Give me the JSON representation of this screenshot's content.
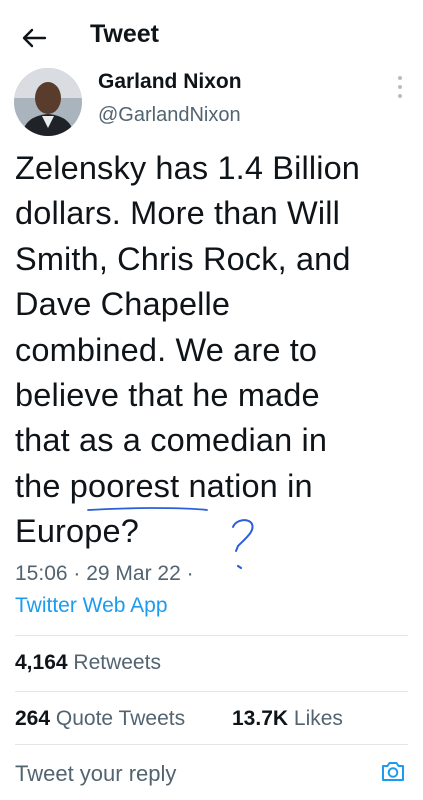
{
  "header": {
    "title": "Tweet"
  },
  "author": {
    "name": "Garland Nixon",
    "handle": "@GarlandNixon"
  },
  "tweet": {
    "text": "Zelensky has 1.4 Billion\ndollars. More than Will\nSmith, Chris Rock, and\nDave Chapelle\ncombined. We are to\nbelieve that he made\nthat as a comedian in\nthe poorest nation in\nEurope?",
    "timestamp": "15:06 · 29 Mar 22 ·",
    "source": "Twitter Web App"
  },
  "stats": {
    "retweets_count": "4,164",
    "retweets_label": "Retweets",
    "quotes_count": "264",
    "quotes_label": "Quote Tweets",
    "likes_count": "13.7K",
    "likes_label": "Likes"
  },
  "reply": {
    "placeholder": "Tweet your reply"
  },
  "colors": {
    "accent": "#1d9bf0",
    "text": "#0f1419",
    "muted": "#536471",
    "annotation_ink": "#2b5fd9"
  },
  "icons": [
    "arrow-left-icon",
    "more-icon",
    "camera-icon"
  ]
}
